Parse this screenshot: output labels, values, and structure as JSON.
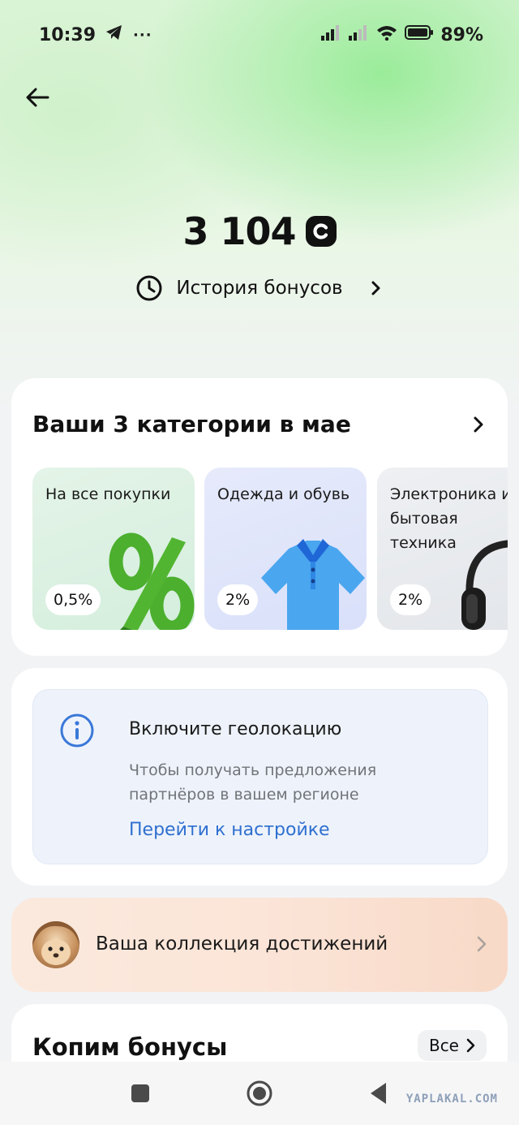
{
  "status_bar": {
    "time": "10:39",
    "telegram_icon": "telegram-icon",
    "more_dots": "···",
    "battery_percent": "89%"
  },
  "header": {
    "back_icon": "arrow-left-icon",
    "balance": "3 104",
    "currency_icon": "bonus-coin-icon",
    "history_label": "История бонусов"
  },
  "categories": {
    "title": "Ваши 3 категории в мае",
    "items": [
      {
        "label": "На все покупки",
        "percent": "0,5%",
        "icon": "percent-3d-icon"
      },
      {
        "label": "Одежда и обувь",
        "percent": "2%",
        "icon": "polo-shirt-icon"
      },
      {
        "label": "Электроника и\nбытовая\nтехника",
        "percent": "2%",
        "icon": "headphones-icon"
      }
    ]
  },
  "geo": {
    "title": "Включите геолокацию",
    "text": "Чтобы получать предложения партнёров в вашем регионе",
    "link": "Перейти к настройке"
  },
  "achievements": {
    "label": "Ваша коллекция достижений"
  },
  "saving": {
    "title": "Копим бонусы",
    "all_label": "Все"
  },
  "watermark": "YAPLAKAL.COM",
  "colors": {
    "accent_green": "#9fe89a",
    "link_blue": "#2f6fd0",
    "achievement_bg": "#fbe5d8"
  }
}
